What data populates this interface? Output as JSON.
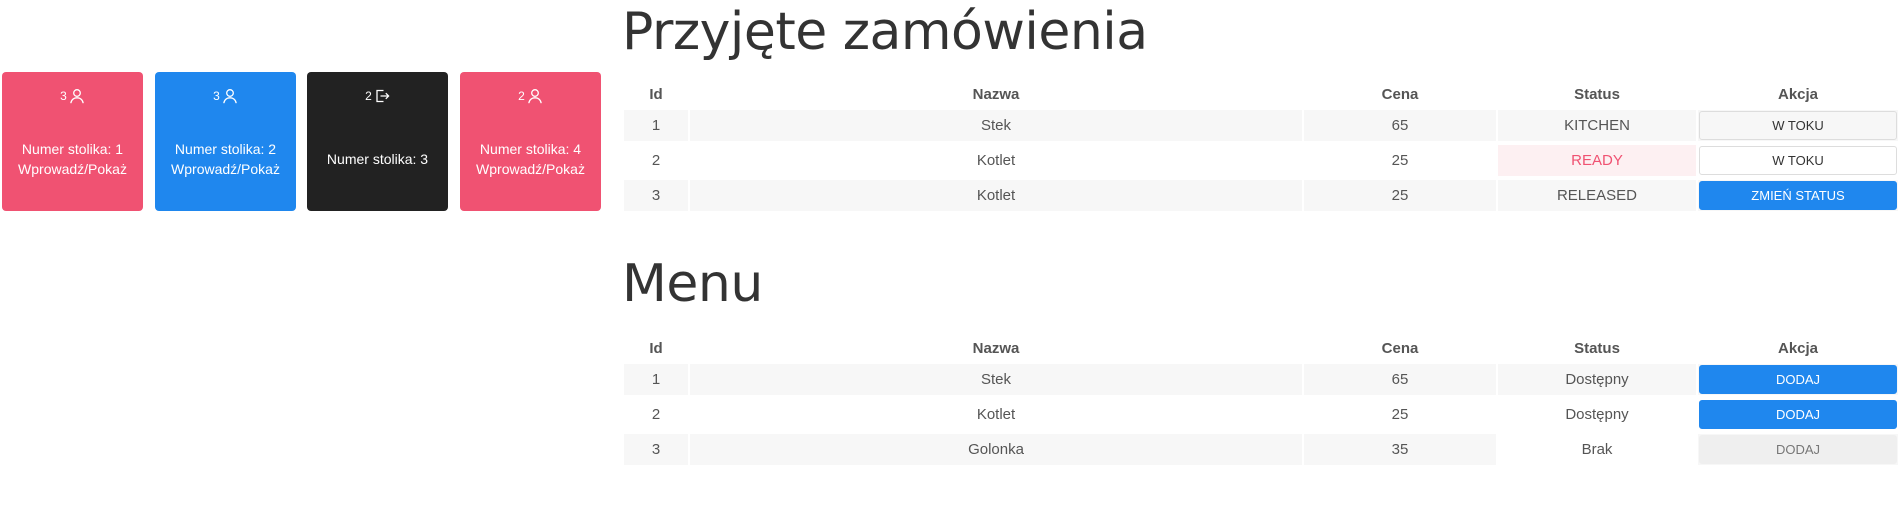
{
  "tables": [
    {
      "count": "3",
      "icon": "person-icon",
      "number_label": "Numer stolika: 1",
      "action_label": "Wprowadź/Pokaż",
      "color": "#f05272"
    },
    {
      "count": "3",
      "icon": "person-icon",
      "number_label": "Numer stolika: 2",
      "action_label": "Wprowadź/Pokaż",
      "color": "#1f87ee"
    },
    {
      "count": "2",
      "icon": "sign-out-icon",
      "number_label": "Numer stolika: 3",
      "action_label": "",
      "color": "#222222"
    },
    {
      "count": "2",
      "icon": "person-icon",
      "number_label": "Numer stolika: 4",
      "action_label": "Wprowadź/Pokaż",
      "color": "#f05272"
    }
  ],
  "orders": {
    "title": "Przyjęte zamówienia",
    "headers": {
      "id": "Id",
      "name": "Nazwa",
      "price": "Cena",
      "status": "Status",
      "action": "Akcja"
    },
    "rows": [
      {
        "id": "1",
        "name": "Stek",
        "price": "65",
        "status": "KITCHEN",
        "action": "W TOKU"
      },
      {
        "id": "2",
        "name": "Kotlet",
        "price": "25",
        "status": "READY",
        "action": "W TOKU"
      },
      {
        "id": "3",
        "name": "Kotlet",
        "price": "25",
        "status": "RELEASED",
        "action": "ZMIEŃ STATUS"
      }
    ]
  },
  "menu": {
    "title": "Menu",
    "headers": {
      "id": "Id",
      "name": "Nazwa",
      "price": "Cena",
      "status": "Status",
      "action": "Akcja"
    },
    "rows": [
      {
        "id": "1",
        "name": "Stek",
        "price": "65",
        "status": "Dostępny",
        "action": "DODAJ"
      },
      {
        "id": "2",
        "name": "Kotlet",
        "price": "25",
        "status": "Dostępny",
        "action": "DODAJ"
      },
      {
        "id": "3",
        "name": "Golonka",
        "price": "35",
        "status": "Brak",
        "action": "DODAJ"
      }
    ]
  },
  "colors": {
    "accent_blue": "#1f87ee",
    "accent_pink": "#f05272",
    "dark": "#222222"
  }
}
